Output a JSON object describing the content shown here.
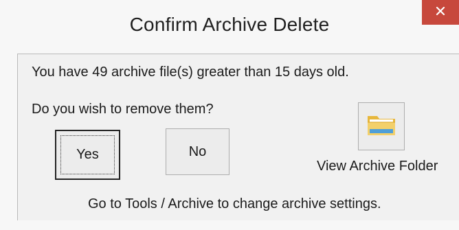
{
  "dialog": {
    "title": "Confirm Archive Delete",
    "close_icon": "close-icon",
    "message": "You have 49 archive file(s) greater than 15 days old.",
    "question": "Do you wish to remove them?",
    "yes_label": "Yes",
    "no_label": "No",
    "folder_icon": "folder-icon",
    "view_folder_label": "View Archive Folder",
    "footer_note": "Go to Tools / Archive to change archive settings."
  },
  "colors": {
    "close_button": "#c7483c",
    "background": "#f1f1f1",
    "button_face": "#ececec",
    "folder_yellow": "#f2c94c",
    "folder_blue": "#4f9fd8"
  }
}
